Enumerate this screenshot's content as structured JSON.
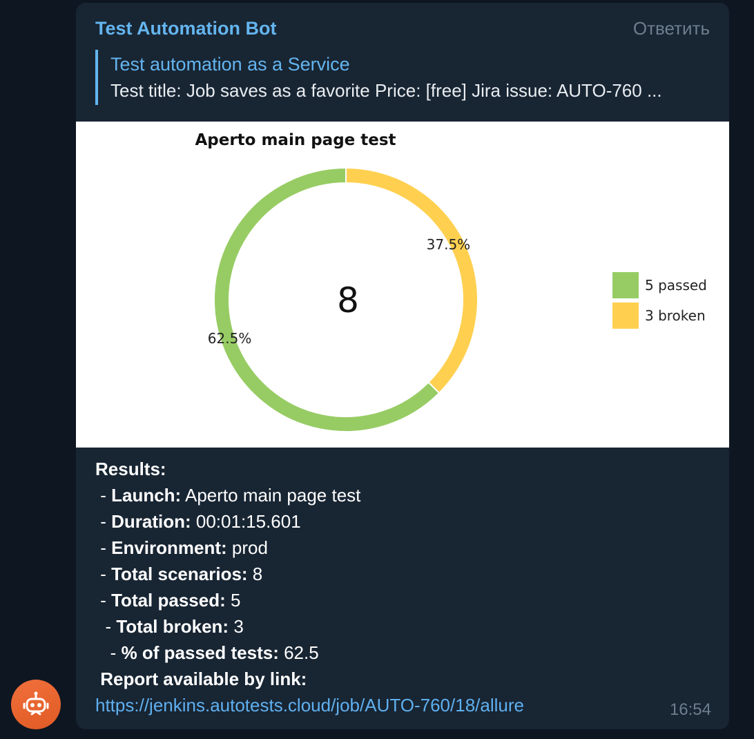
{
  "message": {
    "sender": "Test Automation Bot",
    "reply_label": "Ответить",
    "time": "16:54"
  },
  "quote": {
    "title": "Test automation as a Service",
    "text": "Test title: Job saves as a favorite Price: [free] Jira issue: AUTO-760 ..."
  },
  "chart_data": {
    "type": "pie",
    "title": "Aperto main page test",
    "center_label": "8",
    "categories": [
      "passed",
      "broken"
    ],
    "values": [
      5,
      3
    ],
    "percent_labels": [
      "62.5%",
      "37.5%"
    ],
    "legend": [
      "5 passed",
      "3 broken"
    ],
    "colors": [
      "#97cc64",
      "#ffd050"
    ],
    "legend_position": "right"
  },
  "results": {
    "heading": "Results:",
    "rows": [
      {
        "prefix": " - ",
        "key": "Launch:",
        "value": " Aperto main page test"
      },
      {
        "prefix": " - ",
        "key": "Duration:",
        "value": " 00:01:15.601"
      },
      {
        "prefix": " - ",
        "key": "Environment:",
        "value": " prod"
      },
      {
        "prefix": " - ",
        "key": "Total scenarios:",
        "value": " 8"
      },
      {
        "prefix": " - ",
        "key": "Total passed:",
        "value": " 5"
      },
      {
        "prefix": "  - ",
        "key": "Total broken:",
        "value": " 3"
      },
      {
        "prefix": "   - ",
        "key": "% of passed tests:",
        "value": " 62.5"
      }
    ],
    "report_label": "Report available by link:",
    "report_link": "https://jenkins.autotests.cloud/job/AUTO-760/18/allure"
  }
}
